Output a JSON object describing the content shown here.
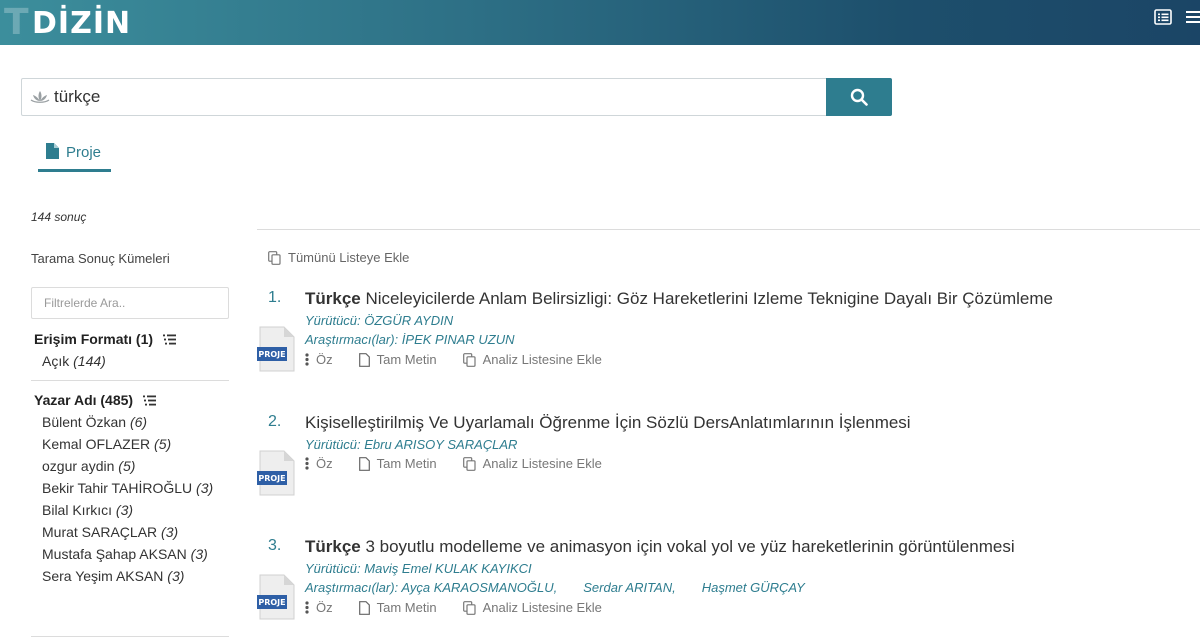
{
  "header": {
    "logo_text": "DİZİN",
    "icons": [
      "list-view-icon",
      "menu-icon"
    ]
  },
  "search": {
    "value": "türkçe",
    "placeholder": "",
    "button_icon": "search-icon"
  },
  "tabs": [
    {
      "label": "Proje",
      "icon": "document-icon",
      "active": true
    }
  ],
  "result_count": "144 sonuç",
  "sidebar": {
    "title": "Tarama Sonuç Kümeleri",
    "filter_placeholder": "Filtrelerde Ara..",
    "facets": [
      {
        "label": "Erişim Formatı (1)",
        "items": [
          {
            "label": "Açık",
            "count": "(144)"
          }
        ]
      },
      {
        "label": "Yazar Adı (485)",
        "items": [
          {
            "label": "Bülent Özkan",
            "count": "(6)"
          },
          {
            "label": "Kemal OFLAZER",
            "count": "(5)"
          },
          {
            "label": "ozgur aydin",
            "count": "(5)"
          },
          {
            "label": "Bekir Tahir TAHİROĞLU",
            "count": "(3)"
          },
          {
            "label": "Bilal Kırkıcı",
            "count": "(3)"
          },
          {
            "label": "Murat SARAÇLAR",
            "count": "(3)"
          },
          {
            "label": "Mustafa Şahap AKSAN",
            "count": "(3)"
          },
          {
            "label": "Sera Yeşim AKSAN",
            "count": "(3)"
          }
        ]
      }
    ]
  },
  "results_toolbar": {
    "add_all_label": "Tümünü Listeye Ekle"
  },
  "results": [
    {
      "number": "1.",
      "title_highlight": "Türkçe",
      "title_rest": " Niceleyicilerde Anlam Belirsizligi: Göz Hareketlerini Izleme Teknigine Dayalı Bir Çözümleme",
      "executor": "Yürütücü: ÖZGÜR AYDIN",
      "researchers_label": "Araştırmacı(lar):",
      "researchers": [
        "İPEK PINAR UZUN"
      ],
      "badge": "PROJE",
      "actions": [
        "Öz",
        "Tam Metin",
        "Analiz Listesine Ekle"
      ]
    },
    {
      "number": "2.",
      "title_highlight": "",
      "title_rest": "Kişiselleştirilmiş Ve Uyarlamalı Öğrenme İçin Sözlü DersAnlatımlarının İşlenmesi",
      "executor": "Yürütücü: Ebru ARISOY SARAÇLAR",
      "researchers_label": "",
      "researchers": [],
      "badge": "PROJE",
      "actions": [
        "Öz",
        "Tam Metin",
        "Analiz Listesine Ekle"
      ]
    },
    {
      "number": "3.",
      "title_highlight": "Türkçe",
      "title_rest": " 3 boyutlu modelleme ve animasyon için vokal yol ve yüz hareketlerinin görüntülenmesi",
      "executor": "Yürütücü: Maviş Emel KULAK KAYIKCI",
      "researchers_label": "Araştırmacı(lar):",
      "researchers": [
        "Ayça KARAOSMANOĞLU,",
        "Serdar ARITAN,",
        "Haşmet GÜRÇAY"
      ],
      "badge": "PROJE",
      "actions": [
        "Öz",
        "Tam Metin",
        "Analiz Listesine Ekle"
      ]
    }
  ]
}
